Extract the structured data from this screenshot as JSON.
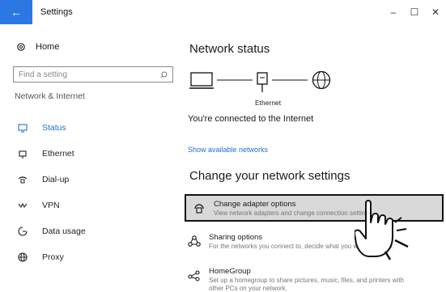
{
  "titlebar": {
    "back": "←",
    "title": "Settings",
    "minimize": "–",
    "maximize": "☐",
    "close": "✕"
  },
  "sidebar": {
    "home": "Home",
    "search_placeholder": "Find a setting",
    "section": "Network & Internet",
    "items": [
      {
        "label": "Status",
        "icon": "status-icon",
        "active": true
      },
      {
        "label": "Ethernet",
        "icon": "ethernet-icon"
      },
      {
        "label": "Dial-up",
        "icon": "dialup-icon"
      },
      {
        "label": "VPN",
        "icon": "vpn-icon"
      },
      {
        "label": "Data usage",
        "icon": "data-usage-icon"
      },
      {
        "label": "Proxy",
        "icon": "proxy-icon"
      }
    ]
  },
  "main": {
    "status_heading": "Network status",
    "ethernet_label": "Ethernet",
    "connected_text": "You're connected to the Internet",
    "show_networks": "Show available networks",
    "change_heading": "Change your network settings",
    "options": [
      {
        "title": "Change adapter options",
        "desc": "View network adapters and change connection settings."
      },
      {
        "title": "Sharing options",
        "desc": "For the networks you connect to, decide what you want to share."
      },
      {
        "title": "HomeGroup",
        "desc": "Set up a homegroup to share pictures, music, files, and printers with",
        "desc2": "other PCs on your network."
      }
    ]
  },
  "colors": {
    "accent": "#1f6fd6",
    "back_button": "#2b78e4",
    "highlight_bg": "#d9d9d9"
  }
}
